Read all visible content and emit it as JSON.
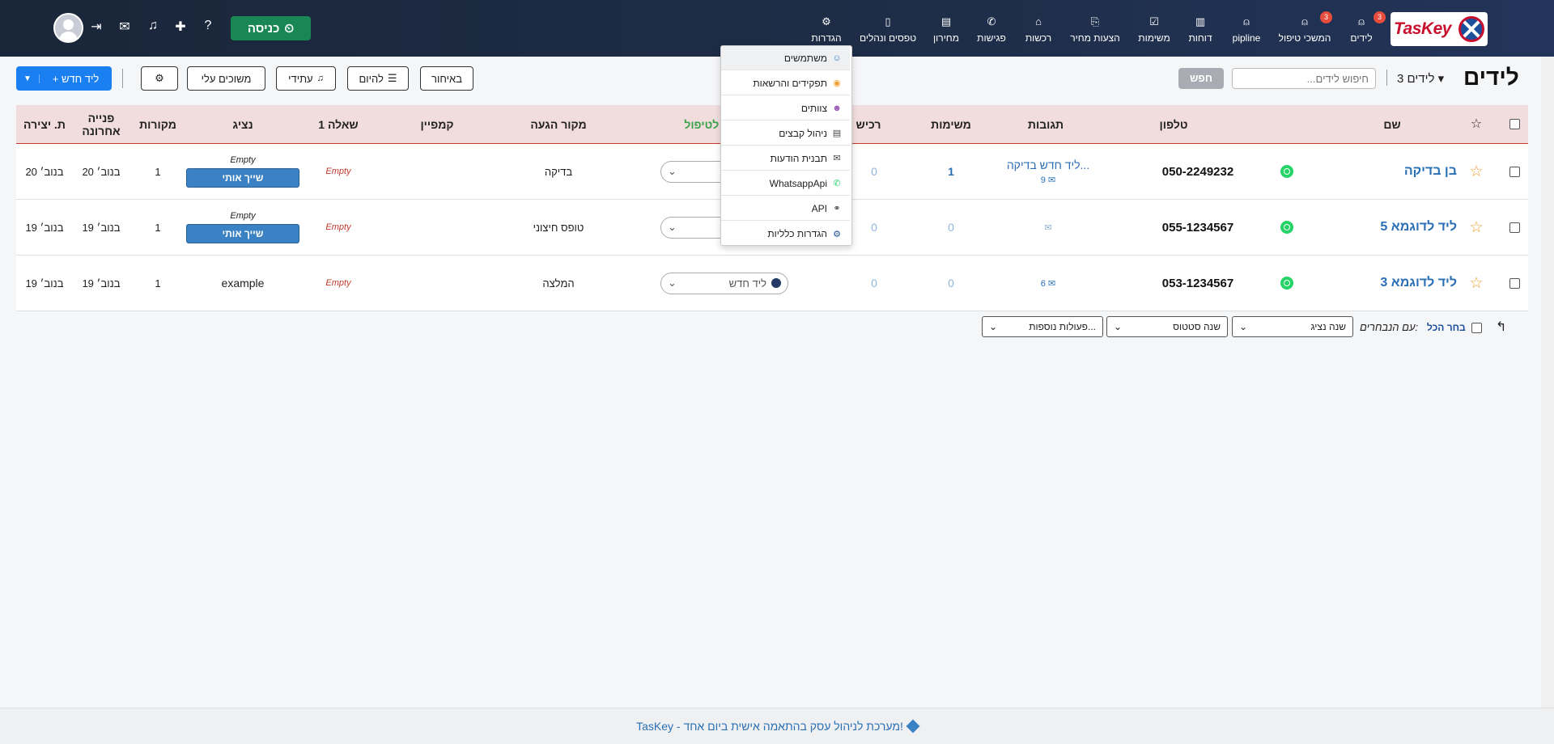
{
  "app": {
    "logo_text": "TasKey"
  },
  "nav": {
    "items": [
      {
        "label": "לידים",
        "icon": "⍝",
        "badge": "3"
      },
      {
        "label": "המשכי טיפול",
        "icon": "⍝",
        "badge": "3"
      },
      {
        "label": "pipline",
        "icon": "⍝",
        "badge": ""
      },
      {
        "label": "דוחות",
        "icon": "▥",
        "badge": ""
      },
      {
        "label": "משימות",
        "icon": "☑",
        "badge": ""
      },
      {
        "label": "הצעות מחיר",
        "icon": "⎘",
        "badge": ""
      },
      {
        "label": "רכשות",
        "icon": "⌂",
        "badge": ""
      },
      {
        "label": "פגישות",
        "icon": "✆",
        "badge": ""
      },
      {
        "label": "מחירון",
        "icon": "▤",
        "badge": ""
      },
      {
        "label": "טפסים ונהלים",
        "icon": "▯",
        "badge": ""
      },
      {
        "label": "הגדרות",
        "icon": "⚙",
        "badge": ""
      }
    ],
    "enter_label": "כניסה",
    "enter_icon": "⏲",
    "icons": {
      "help": "?",
      "plus": "✚",
      "bell": "♫",
      "chat": "✉",
      "login": "⇥"
    }
  },
  "toolbar": {
    "title": "לידים",
    "count": "3 לידים",
    "search_placeholder": "חיפוש לידים...",
    "search_label": "חפש",
    "late_label": "באיחור",
    "today_label": "להיום",
    "future_label": "עתידי",
    "mine_label": "משוכים עלי",
    "settings_icon": "⚙",
    "new_lead_label": "+ ליד חדש"
  },
  "table": {
    "columns": {
      "name": "שם",
      "phone": "טלפון",
      "responses": "תגובות",
      "tasks": "משימות",
      "purchases": "רכיש",
      "status": "ם לטיפול ▼",
      "source": "מקור הגעה",
      "campaign": "קמפיין",
      "question": "שאלה 1",
      "agent": "נציג",
      "sources_count": "מקורות",
      "last_contact": "פנייה אחרונה",
      "created": "ת. יצירה"
    },
    "rows": [
      {
        "name": "בן בדיקה",
        "phone": "050-2249232",
        "response_text": "ליד חדש בדיקה...",
        "response_count": "9",
        "tasks": "1",
        "purchases": "0",
        "status": "",
        "source": "בדיקה",
        "question": "Empty",
        "agent": "Empty",
        "assign": "שייך אותי",
        "sources_count": "1",
        "last_contact": "20 בנוב׳",
        "created": "20 בנוב׳"
      },
      {
        "name": "ליד לדוגמא 5",
        "phone": "055-1234567",
        "response_text": "",
        "response_count": "",
        "tasks": "0",
        "purchases": "0",
        "status": "",
        "source": "טופס חיצוני",
        "question": "Empty",
        "agent": "Empty",
        "assign": "שייך אותי",
        "sources_count": "1",
        "last_contact": "19 בנוב׳",
        "created": "19 בנוב׳"
      },
      {
        "name": "ליד לדוגמא 3",
        "phone": "053-1234567",
        "response_text": "",
        "response_count": "6",
        "tasks": "0",
        "purchases": "0",
        "status": "ליד חדש",
        "source": "המלצה",
        "question": "Empty",
        "agent": "example",
        "assign": "",
        "sources_count": "1",
        "last_contact": "19 בנוב׳",
        "created": "19 בנוב׳"
      }
    ]
  },
  "bulk": {
    "select_all": "בחר הכל",
    "with_selected": "עם הנבחרים:",
    "change_agent": "שנה נציג",
    "change_status": "שנה סטטוס",
    "more_actions": "פעולות נוספות..."
  },
  "settings_menu": {
    "items": [
      {
        "label": "משתמשים",
        "icon": "☺",
        "color": "#3b82c4"
      },
      {
        "label": "תפקידים והרשאות",
        "icon": "◉",
        "color": "#f0a030"
      },
      {
        "label": "צוותים",
        "icon": "☻",
        "color": "#9b59b6"
      },
      {
        "label": "ניהול קבצים",
        "icon": "▤",
        "color": "#444444"
      },
      {
        "label": "תבנית הודעות",
        "icon": "✉",
        "color": "#444444"
      },
      {
        "label": "WhatsappApi",
        "icon": "✆",
        "color": "#25d366"
      },
      {
        "label": "API",
        "icon": "⚭",
        "color": "#444444"
      },
      {
        "label": "הגדרות כלליות",
        "icon": "⚙",
        "color": "#1b4e9b"
      }
    ]
  },
  "footer": {
    "text": "TasKey - מערכת לניהול עסק בהתאמה אישית ביום אחד!"
  },
  "colors": {
    "accent": "#1a7ff0",
    "header_bg": "#1e2d48",
    "enter": "#198754",
    "table_header": "#f1dddd"
  }
}
